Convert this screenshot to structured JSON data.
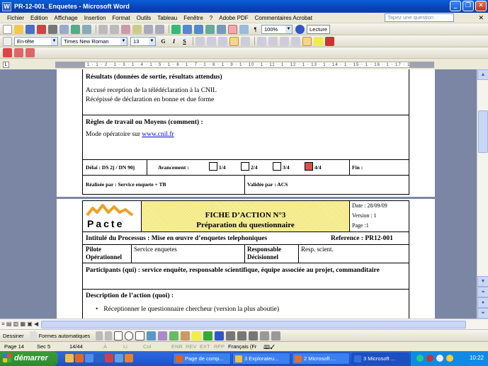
{
  "window": {
    "title": "PR-12-001_Enquetes - Microsoft Word"
  },
  "menu": {
    "items": [
      "Fichier",
      "Edition",
      "Affichage",
      "Insertion",
      "Format",
      "Outils",
      "Tableau",
      "Fenêtre",
      "?",
      "Adobe PDF",
      "Commentaires Acrobat"
    ],
    "help_placeholder": "Tapez une question"
  },
  "toolbar": {
    "zoom": "100%",
    "reading_label": "Lecture",
    "style": "En-tête",
    "font": "Times New Roman",
    "size": "13",
    "bold": "G",
    "italic": "I",
    "underline": "S"
  },
  "ruler": {
    "marks": "· 1 · 2 · 1 · 1 · 1 · 2 · 1 · 3 · 1 · 4 · 1 · 5 · 1 · 6 · 1 · 7 · 1 · 8 · 1 · 9 · 1 · 10 · 1 · 11 · 1 · 12 · 1 · 13 · 1 · 14 · 1 · 15 · 1 · 16 · 1 · 17 · 19"
  },
  "doc": {
    "results_title": "Résultats (données de sortie, résultats attendus)",
    "results_line1": "Accusé reception de la télédéclaration à la CNIL",
    "results_line2": "Récépissé de déclaration en bonne et due forme",
    "rules_title": "Règles de travail ou Moyens (comment) :",
    "rules_text": "Mode opératoire sur ",
    "rules_link": "www.cnil.fr",
    "delay": "Délai : DS 2j / DN 90j",
    "progress": "Avancement :",
    "q1": "1/4",
    "q2": "2/4",
    "q3": "3/4",
    "q4": "4/4",
    "end": "Fin :",
    "done_by": "Réalisée par : Service enquete + TB",
    "validated_by": "Validée par : ACS",
    "logo_text": "Pacte",
    "sheet_title": "FICHE D’ACTION N°3",
    "sheet_subtitle": "Préparation du questionnaire",
    "date": "Date : 28/09/09",
    "version": "Version : 1",
    "page": "Page :1",
    "process": "Intitulé du Processus : Mise en œuvre d’enquetes telephoniques",
    "reference": "Reference : PR12-001",
    "pilot_label": "Pilote Opérationnel",
    "pilot_value": "Service enquetes",
    "resp_label": "Responsable Décisionnel",
    "resp_value": "Resp. scient.",
    "participants": "Participants (qui) : service enquête, responsable scientifique, équipe associée au projet, commanditaire",
    "description": "Description de l’action (quoi) :",
    "bullet1": "Réceptionner le questionnaire chercheur (version la plus aboutie)"
  },
  "drawing": {
    "draw": "Dessiner",
    "autoshapes": "Formes automatiques"
  },
  "status": {
    "page": "Page 14",
    "section": "Sec 5",
    "pages": "14/44",
    "at": "À",
    "li": "Li",
    "col": "Col",
    "enr": "ENR",
    "rev": "REV",
    "ext": "EXT",
    "rfp": "RFP",
    "lang": "Français (Fr"
  },
  "taskbar": {
    "start": "démarrer",
    "tasks": [
      "Page de comp...",
      "3 Explorateu...",
      "2 Microsoft ...",
      "3 Microsoft ..."
    ],
    "clock": "10:22"
  },
  "colors": {
    "accent": "#0a5fd8",
    "header_fill": "#f7f09a",
    "logo_orange": "#f0a020",
    "checkbox_red": "#e04d4d"
  }
}
